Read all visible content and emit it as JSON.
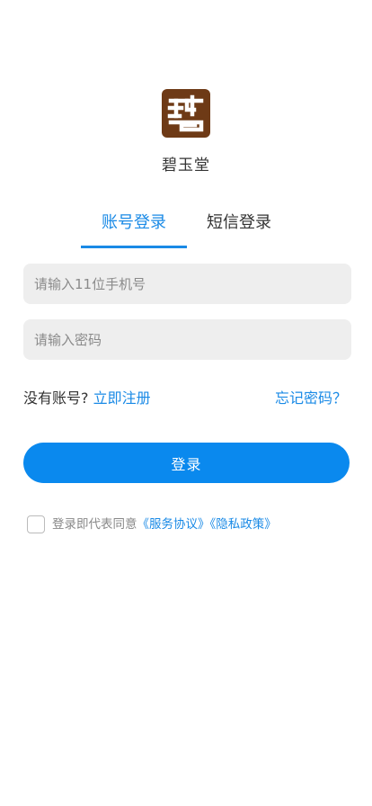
{
  "app": {
    "name": "碧玉堂",
    "logo_icon": "seal-logo-icon",
    "logo_color": "#6e3a16"
  },
  "tabs": [
    {
      "label": "账号登录",
      "active": true
    },
    {
      "label": "短信登录",
      "active": false
    }
  ],
  "form": {
    "phone_placeholder": "请输入11位手机号",
    "phone_value": "",
    "password_placeholder": "请输入密码",
    "password_value": ""
  },
  "links": {
    "no_account_text": "没有账号?",
    "register_label": "立即注册",
    "forgot_label": "忘记密码？"
  },
  "login_button_label": "登录",
  "agreement": {
    "checked": false,
    "prefix": "登录即代表同意",
    "service_link": "《服务协议》",
    "privacy_link": "《隐私政策》"
  },
  "colors": {
    "accent": "#1a8ae6",
    "button": "#0a89ee",
    "input_bg": "#eeeeee"
  }
}
